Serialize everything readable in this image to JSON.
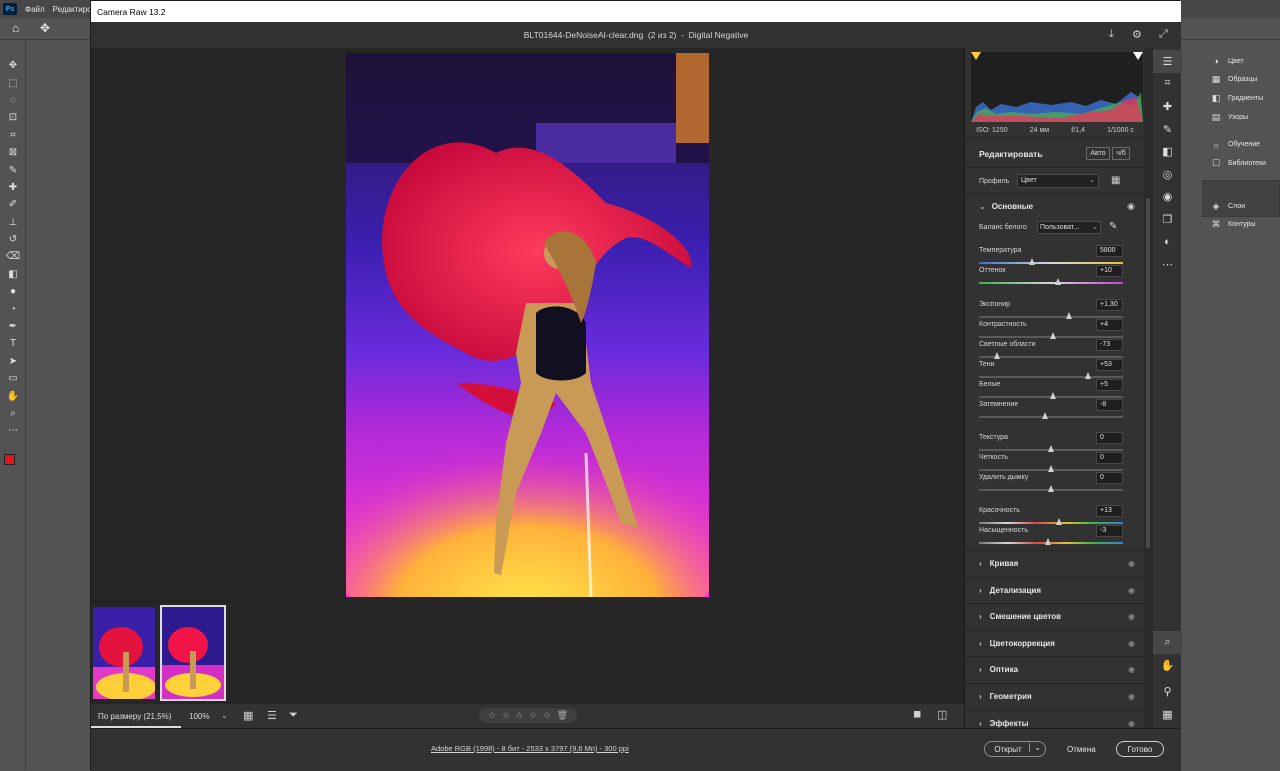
{
  "photoshop": {
    "logo": "Ps",
    "menu": [
      "Файл",
      "Редактиров"
    ],
    "tools": [
      "move-tool",
      "marquee-tool",
      "lasso-tool",
      "object-select-tool",
      "crop-tool",
      "frame-tool",
      "eyedropper-tool",
      "healing-tool",
      "brush-tool",
      "stamp-tool",
      "history-brush-tool",
      "eraser-tool",
      "gradient-tool",
      "blur-tool",
      "dodge-tool",
      "pen-tool",
      "type-tool",
      "path-select-tool",
      "rectangle-tool",
      "hand-tool",
      "zoom-tool",
      "more-tools"
    ],
    "foreground_color": "#e5151c",
    "background_color": "#ffffff",
    "panels": [
      {
        "icon": "color-icon",
        "label": "Цвет"
      },
      {
        "icon": "swatches-icon",
        "label": "Образцы"
      },
      {
        "icon": "gradients-icon",
        "label": "Градиенты"
      },
      {
        "icon": "patterns-icon",
        "label": "Узоры"
      },
      {
        "icon": "learn-icon",
        "label": "Обучение"
      },
      {
        "icon": "libraries-icon",
        "label": "Библиотеки"
      }
    ],
    "layers_panels": [
      {
        "icon": "layers-icon",
        "label": "Слои"
      },
      {
        "icon": "paths-icon",
        "label": "Контуры"
      }
    ]
  },
  "camera_raw": {
    "title": "Camera Raw 13.2",
    "filename": "BLT01644-DeNoiseAI-clear.dng  (2 из 2)  -  Digital Negative",
    "exif": [
      "ISO: 1250",
      "24 мм",
      "f/1,4",
      "1/1000 с"
    ],
    "edit_title": "Редактировать",
    "auto_label": "Авто",
    "bw_label": "ч/б",
    "profile_label": "Профиль",
    "profile_value": "Цвет",
    "basic_title": "Основные",
    "wb_label": "Баланс белого",
    "wb_value": "Пользоват...",
    "sliders": [
      {
        "label": "Температура",
        "value": "5800",
        "pos": 0.37,
        "grad": "temp"
      },
      {
        "label": "Оттенок",
        "value": "+10",
        "pos": 0.55,
        "grad": "tint"
      },
      {
        "label": "Экспонир",
        "value": "+1,30",
        "pos": 0.63,
        "grad": "none"
      },
      {
        "label": "Контрастность",
        "value": "+4",
        "pos": 0.52,
        "grad": "none"
      },
      {
        "label": "Светлые области",
        "value": "-73",
        "pos": 0.13,
        "grad": "none"
      },
      {
        "label": "Тени",
        "value": "+53",
        "pos": 0.76,
        "grad": "none"
      },
      {
        "label": "Белые",
        "value": "+5",
        "pos": 0.52,
        "grad": "none"
      },
      {
        "label": "Затемнение",
        "value": "-8",
        "pos": 0.46,
        "grad": "none"
      },
      {
        "label": "Текстура",
        "value": "0",
        "pos": 0.5,
        "grad": "none"
      },
      {
        "label": "Четкость",
        "value": "0",
        "pos": 0.5,
        "grad": "none"
      },
      {
        "label": "Удалить дымку",
        "value": "0",
        "pos": 0.5,
        "grad": "none"
      },
      {
        "label": "Красочность",
        "value": "+13",
        "pos": 0.56,
        "grad": "vib"
      },
      {
        "label": "Насыщенность",
        "value": "-3",
        "pos": 0.48,
        "grad": "sat"
      }
    ],
    "sections": [
      "Кривая",
      "Детализация",
      "Смешение цветов",
      "Цветокоррекция",
      "Оптика",
      "Геометрия",
      "Эффекты"
    ],
    "zoom_fit": "По размеру (21,5%)",
    "zoom_100": "100%",
    "footer_info": "Adobe RGB (1998) - 8 бит - 2533 x 3797 (9,6 Мп) - 300 ppi",
    "open_button": "Открыт",
    "cancel_button": "Отмена",
    "done_button": "Готово"
  }
}
